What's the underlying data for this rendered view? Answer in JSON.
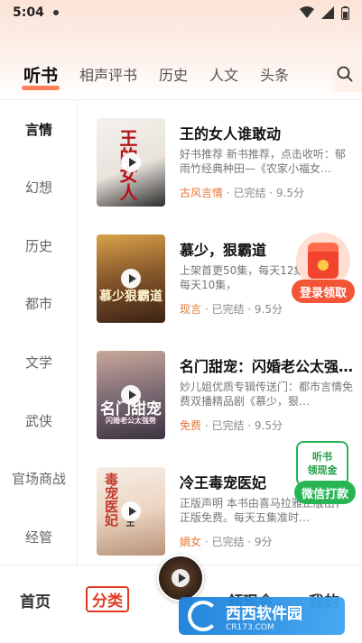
{
  "status_bar": {
    "time": "5:04"
  },
  "tabs": [
    {
      "label": "听书",
      "active": true
    },
    {
      "label": "相声评书"
    },
    {
      "label": "历史"
    },
    {
      "label": "人文"
    },
    {
      "label": "头条"
    }
  ],
  "sidebar": {
    "items": [
      {
        "label": "言情",
        "active": true
      },
      {
        "label": "幻想"
      },
      {
        "label": "历史"
      },
      {
        "label": "都市"
      },
      {
        "label": "文学"
      },
      {
        "label": "武侠"
      },
      {
        "label": "官场商战"
      },
      {
        "label": "经管"
      }
    ]
  },
  "books": [
    {
      "title": "王的女人谁敢动",
      "desc": "好书推荐  新书推荐，点击收听：郁雨竹经典种田—《农家小福女…",
      "genre": "古风言情",
      "meta": "· 已完结 · 9.5分",
      "cover_text": "王的女人"
    },
    {
      "title": "慕少，狠霸道",
      "desc": "上架首更50集，每天12集，第一周每天10集，",
      "genre": "现言",
      "meta": "· 已完结 · 9.5分",
      "cover_text": "慕少狠霸道"
    },
    {
      "title": "名门甜宠：闪婚老公太强…",
      "desc": "妙儿姐优质专辑传送门：都市言情免费双播精品剧《慕少，狠…",
      "genre": "免费",
      "meta": "· 已完结 · 9.5分",
      "cover_text": "名门甜宠",
      "cover_sub": "闪婚老公太强势"
    },
    {
      "title": "冷王毒宠医妃",
      "desc": "正版声明  本书由喜马拉雅正版出，正版免费。每天五集准时…",
      "genre": "嫡女",
      "meta": "· 已完结 · 9分",
      "cover_text": "毒宠医妃",
      "cover_sub": "冷王"
    }
  ],
  "float_red": {
    "label": "登录领取"
  },
  "float_green": {
    "line1": "听书",
    "line2": "领现金",
    "button": "微信打款"
  },
  "bottom_nav": {
    "home": "首页",
    "category": "分类",
    "cash": "领现金",
    "mine": "我的"
  },
  "watermark": {
    "main": "西西软件园",
    "sub": "CR173.COM"
  },
  "colors": {
    "accent": "#ff6a3c",
    "genre": "#e6783a",
    "red_float": "#f35636",
    "green_float": "#27b554",
    "nav_active": "#e03a22"
  }
}
